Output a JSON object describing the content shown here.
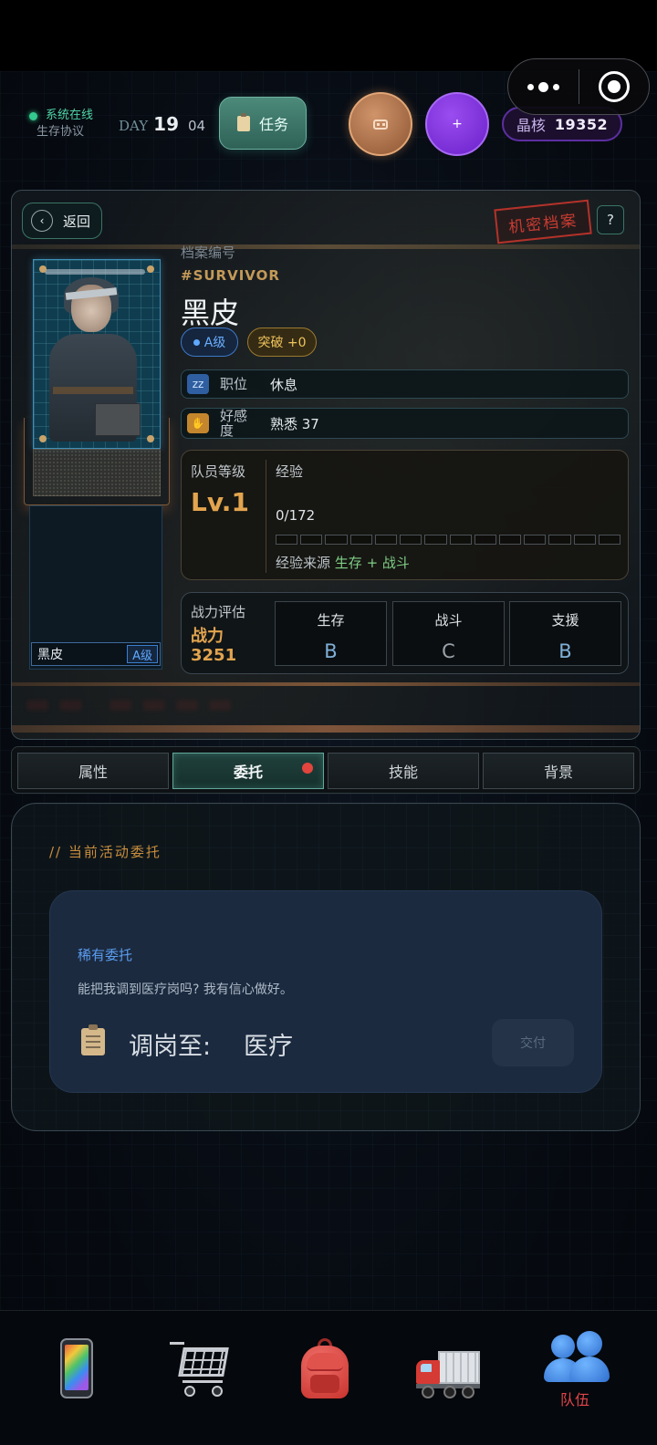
{
  "header": {
    "system_status": "系统在线",
    "protocol": "生存协议",
    "day_label": "DAY",
    "day_number": "19",
    "day_sub": "04",
    "task_button": "任务",
    "plus_button": "+",
    "crystal_label": "晶核",
    "crystal_value": "19352"
  },
  "profile": {
    "back_label": "返回",
    "stamp": "机密档案",
    "help": "?",
    "file_label": "档案编号",
    "file_code": "#SURVIVOR",
    "name": "黑皮",
    "tier": "A级",
    "breakthrough": "突破 +0",
    "role_key": "职位",
    "role_value": "休息",
    "favor_key": "好感度",
    "favor_value": "熟悉 37",
    "card_name": "黑皮",
    "card_tier": "A级"
  },
  "level": {
    "label": "队员等级",
    "value": "Lv.1",
    "exp_label": "经验",
    "exp_value": "0/172",
    "exp_progress": 0,
    "exp_segments": 14,
    "exp_source_label": "经验来源",
    "exp_source_value": "生存 + 战斗"
  },
  "power": {
    "label": "战力评估",
    "name": "战力",
    "value": "3251",
    "stats": [
      {
        "label": "生存",
        "grade": "B",
        "color": "#7fb0d8"
      },
      {
        "label": "战斗",
        "grade": "C",
        "color": "#9aa3aa"
      },
      {
        "label": "支援",
        "grade": "B",
        "color": "#7fb0d8"
      }
    ]
  },
  "tabs": [
    "属性",
    "委托",
    "技能",
    "背景"
  ],
  "active_tab": 1,
  "commission": {
    "section_title": "// 当前活动委托",
    "rarity": "稀有委托",
    "description": "能把我调到医疗岗吗? 我有信心做好。",
    "assign_label": "调岗至:",
    "assign_value": "医疗",
    "deliver_button": "交付"
  },
  "nav": {
    "items": [
      {
        "icon": "phone-icon",
        "label": ""
      },
      {
        "icon": "shopping-cart-icon",
        "label": ""
      },
      {
        "icon": "backpack-icon",
        "label": ""
      },
      {
        "icon": "truck-icon",
        "label": ""
      },
      {
        "icon": "team-icon",
        "label": "队伍"
      }
    ],
    "active_color": "#e0454b"
  }
}
